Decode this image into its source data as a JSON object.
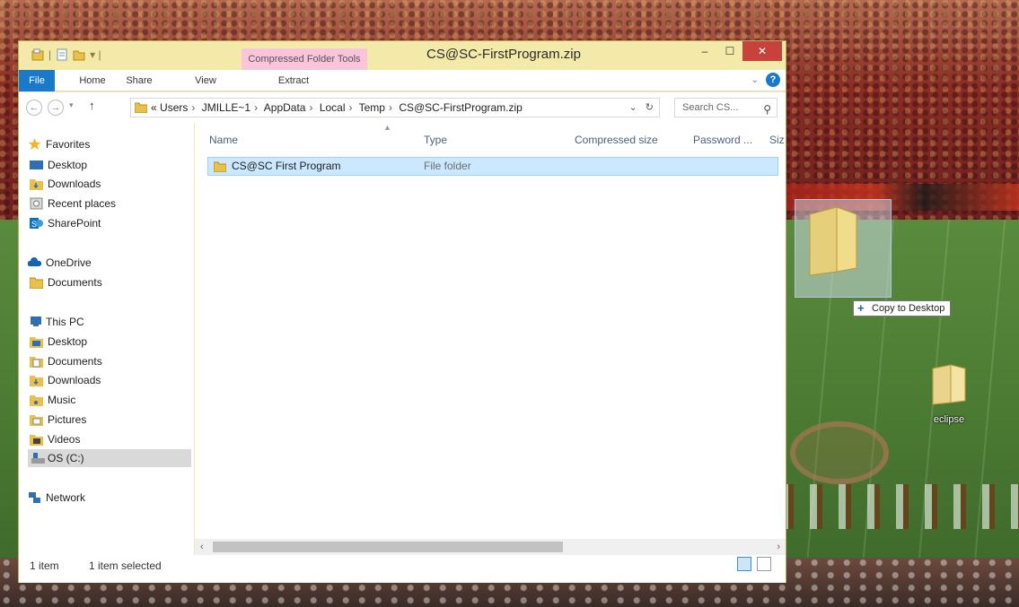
{
  "titlebar": {
    "context_tab": "Compressed Folder Tools",
    "title": "CS@SC-FirstProgram.zip",
    "minimize_icon": "minimize-icon",
    "maximize_icon": "maximize-icon",
    "close_icon": "close-icon"
  },
  "ribbon": {
    "tabs": [
      "File",
      "Home",
      "Share",
      "View",
      "Extract"
    ],
    "help_label": "?"
  },
  "address": {
    "crumbs": [
      "«",
      "Users",
      "JMILLE~1",
      "AppData",
      "Local",
      "Temp",
      "CS@SC-FirstProgram.zip"
    ],
    "search_placeholder": "Search CS..."
  },
  "navpane": {
    "favorites": {
      "label": "Favorites",
      "items": [
        "Desktop",
        "Downloads",
        "Recent places",
        "SharePoint"
      ]
    },
    "onedrive": {
      "label": "OneDrive",
      "items": [
        "Documents"
      ]
    },
    "thispc": {
      "label": "This PC",
      "items": [
        "Desktop",
        "Documents",
        "Downloads",
        "Music",
        "Pictures",
        "Videos",
        "OS (C:)"
      ]
    },
    "network": {
      "label": "Network"
    }
  },
  "content": {
    "columns": [
      "Name",
      "Type",
      "Compressed size",
      "Password ...",
      "Siz"
    ],
    "rows": [
      {
        "name": "CS@SC First Program",
        "type": "File folder"
      }
    ]
  },
  "status": {
    "count": "1 item",
    "selected": "1 item selected"
  },
  "drag": {
    "tooltip": "Copy to Desktop"
  },
  "desktop": {
    "icon_label": "eclipse"
  },
  "colors": {
    "window_frame": "#f3e9a9",
    "file_tab": "#1979ca",
    "context_tab": "#f9c4dc",
    "selection": "#cce8ff",
    "close_button": "#c7423b"
  }
}
